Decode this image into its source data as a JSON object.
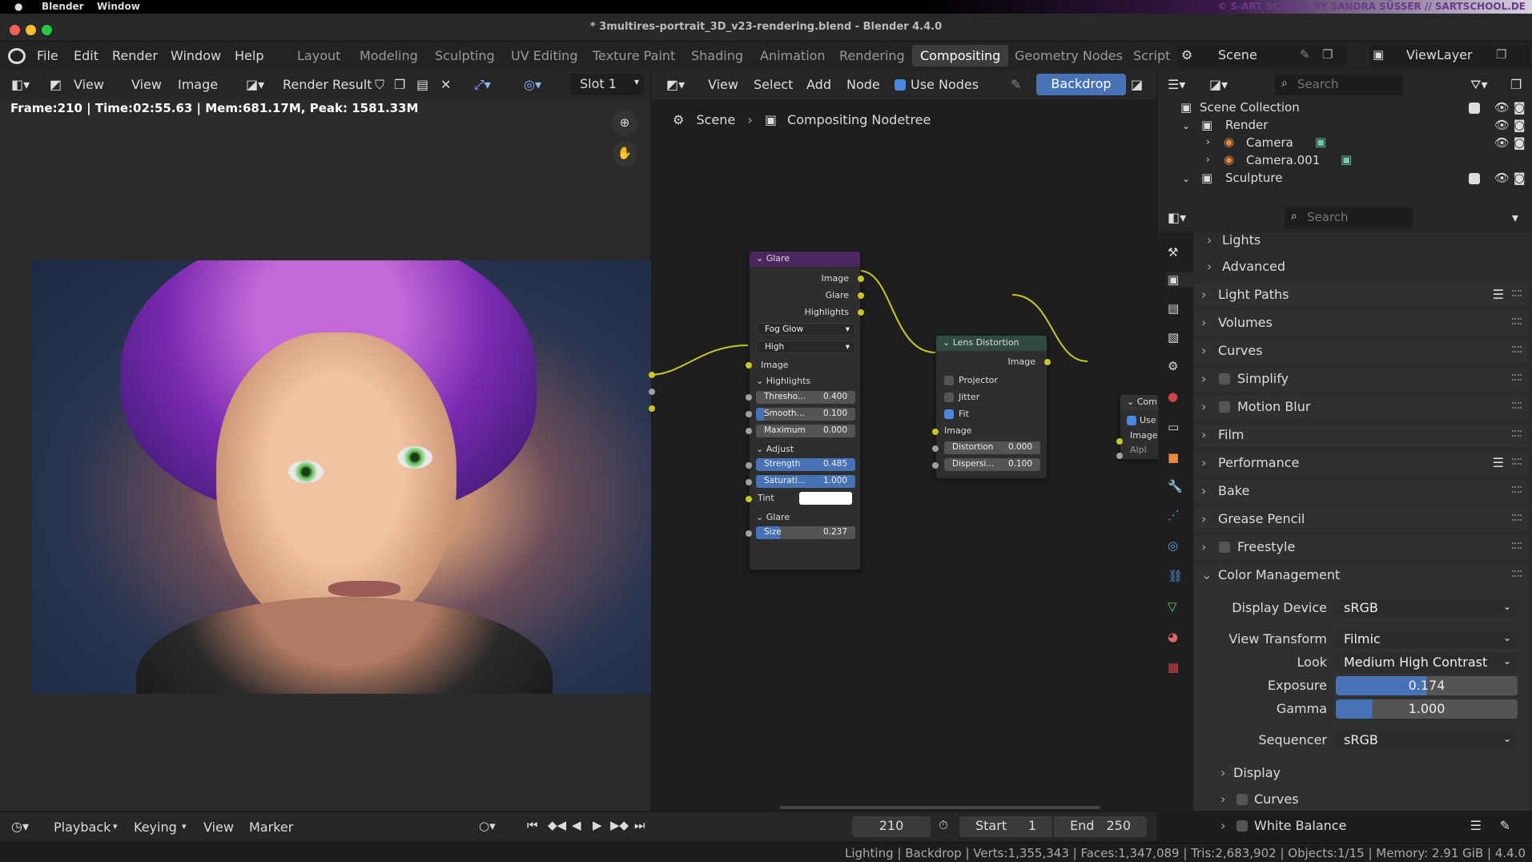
{
  "os": {
    "app": "Blender",
    "menu": "Window",
    "watermark": "© S-ART SCHOOL BY SANDRA SÜSSER // SARTSCHOOL.DE"
  },
  "window": {
    "title": "* 3multires-portrait_3D_v23-rendering.blend - Blender 4.4.0"
  },
  "menus": [
    "File",
    "Edit",
    "Render",
    "Window",
    "Help"
  ],
  "workspaces": [
    "Layout",
    "Modeling",
    "Sculpting",
    "UV Editing",
    "Texture Paint",
    "Shading",
    "Animation",
    "Rendering",
    "Compositing",
    "Geometry Nodes",
    "Script"
  ],
  "active_workspace": "Compositing",
  "top_right": {
    "scene": "Scene",
    "view_layer": "ViewLayer"
  },
  "image_editor": {
    "view": "View",
    "view2": "View",
    "image": "Image",
    "render_result": "Render Result",
    "slot": "Slot 1",
    "stats": "Frame:210 | Time:02:55.63 | Mem:681.17M, Peak: 1581.33M"
  },
  "node_editor": {
    "view": "View",
    "select": "Select",
    "add": "Add",
    "node": "Node",
    "use_nodes": "Use Nodes",
    "backdrop": "Backdrop",
    "breadcrumb_scene": "Scene",
    "breadcrumb_tree": "Compositing Nodetree"
  },
  "glare_node": {
    "title": "Glare",
    "out_image": "Image",
    "out_glare": "Glare",
    "out_highlights": "Highlights",
    "type": "Fog Glow",
    "quality": "High",
    "in_image": "Image",
    "sec_highlights": "Highlights",
    "threshold_label": "Thresho...",
    "threshold": "0.400",
    "smooth_label": "Smooth...",
    "smooth": "0.100",
    "maximum_label": "Maximum",
    "maximum": "0.000",
    "sec_adjust": "Adjust",
    "strength_label": "Strength",
    "strength": "0.485",
    "saturation_label": "Saturati...",
    "saturation": "1.000",
    "tint_label": "Tint",
    "sec_glare": "Glare",
    "size_label": "Size",
    "size": "0.237"
  },
  "lens_node": {
    "title": "Lens Distortion",
    "out_image": "Image",
    "projector": "Projector",
    "jitter": "Jitter",
    "fit": "Fit",
    "in_image": "Image",
    "distortion_label": "Distortion",
    "distortion": "0.000",
    "dispersion_label": "Dispersi...",
    "dispersion": "0.100"
  },
  "composite_node": {
    "title": "Com",
    "use": "Use",
    "image": "Image",
    "alpha": "Alpl"
  },
  "outliner": {
    "search": "Search",
    "collection": "Scene Collection",
    "items": [
      "Render",
      "Camera",
      "Camera.001",
      "Sculpture"
    ]
  },
  "properties": {
    "search": "Search",
    "panels": [
      "Lights",
      "Advanced",
      "Light Paths",
      "Volumes",
      "Curves",
      "Simplify",
      "Motion Blur",
      "Film",
      "Performance",
      "Bake",
      "Grease Pencil",
      "Freestyle",
      "Color Management"
    ],
    "display_device_label": "Display Device",
    "display_device": "sRGB",
    "view_transform_label": "View Transform",
    "view_transform": "Filmic",
    "look_label": "Look",
    "look": "Medium High Contrast",
    "exposure_label": "Exposure",
    "exposure": "0.174",
    "gamma_label": "Gamma",
    "gamma": "1.000",
    "sequencer_label": "Sequencer",
    "sequencer": "sRGB",
    "sub_display": "Display",
    "sub_curves": "Curves",
    "sub_white_balance": "White Balance"
  },
  "timeline": {
    "playback": "Playback",
    "keying": "Keying",
    "view": "View",
    "marker": "Marker",
    "frame": "210",
    "start_label": "Start",
    "start": "1",
    "end_label": "End",
    "end": "250"
  },
  "statusbar": "Lighting | Backdrop | Verts:1,355,343 | Faces:1,347,089 | Tris:2,683,902 | Objects:1/15 | Memory: 2.91 GiB | 4.4.0",
  "colors": {
    "accent": "#4772b3",
    "socket_yellow": "#c7c729",
    "glare_header": "#4b2760",
    "lens_header": "#2e4a43"
  }
}
